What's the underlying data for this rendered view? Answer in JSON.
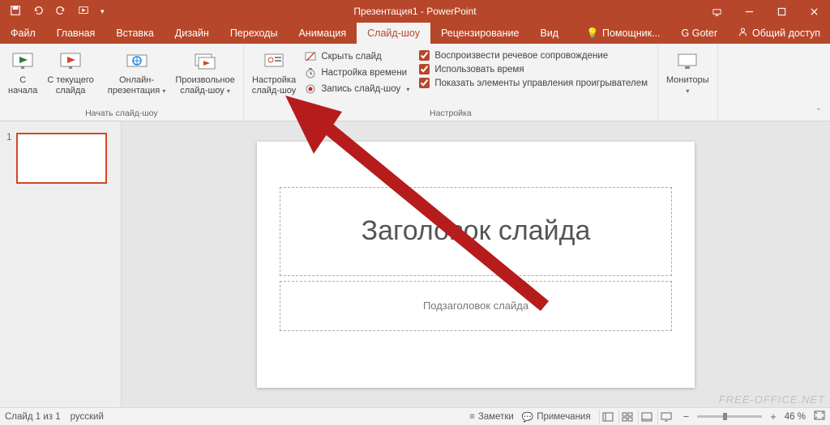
{
  "title": "Презентация1 - PowerPoint",
  "tabs": {
    "file": "Файл",
    "home": "Главная",
    "insert": "Вставка",
    "design": "Дизайн",
    "transitions": "Переходы",
    "animations": "Анимация",
    "slideshow": "Слайд-шоу",
    "review": "Рецензирование",
    "view": "Вид",
    "assistant": "Помощник...",
    "user": "G Goter",
    "share": "Общий доступ"
  },
  "ribbon": {
    "group_start_label": "Начать слайд-шоу",
    "group_setup_label": "Настройка",
    "group_monitors_label": "Мониторы",
    "from_beginning_l1": "С",
    "from_beginning_l2": "начала",
    "from_current_l1": "С текущего",
    "from_current_l2": "слайда",
    "online_l1": "Онлайн-",
    "online_l2": "презентация",
    "custom_l1": "Произвольное",
    "custom_l2": "слайд-шоу",
    "setup_l1": "Настройка",
    "setup_l2": "слайд-шоу",
    "hide_slide": "Скрыть слайд",
    "rehearse": "Настройка времени",
    "record": "Запись слайд-шоу",
    "play_narrations": "Воспроизвести речевое сопровождение",
    "use_timings": "Использовать время",
    "show_controls": "Показать элементы управления проигрывателем",
    "monitors": "Мониторы"
  },
  "thumb": {
    "num": "1"
  },
  "slide": {
    "title_placeholder": "Заголовок слайда",
    "subtitle_placeholder": "Подзаголовок слайда"
  },
  "status": {
    "slide_info": "Слайд 1 из 1",
    "lang": "русский",
    "notes": "Заметки",
    "comments": "Примечания",
    "zoom_pct": "46 %"
  },
  "watermark": "FREE-OFFICE.NET"
}
